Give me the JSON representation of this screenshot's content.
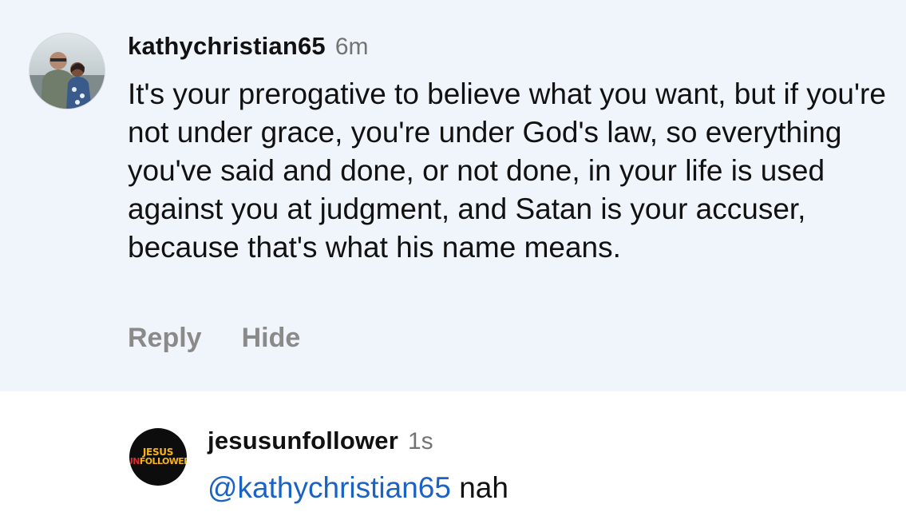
{
  "main_comment": {
    "username": "kathychristian65",
    "timestamp": "6m",
    "avatar_icon": "profile-photo-couple",
    "text": "It's your prerogative to believe what you want, but if you're not under grace, you're under God's law, so everything you've said and done, or not done, in your life is used against you at judgment, and Satan is your accuser, because that's what his name means.",
    "actions": {
      "reply_label": "Reply",
      "hide_label": "Hide"
    }
  },
  "reply_comment": {
    "username": "jesusunfollower",
    "timestamp": "1s",
    "avatar_logo": {
      "line1": "JESUS",
      "line2_prefix": "UN",
      "line2_suffix": "FOLLOWER"
    },
    "mention": "@kathychristian65",
    "text": " nah"
  },
  "colors": {
    "highlight_background": "#eff5fb",
    "mention_blue": "#1a63c4",
    "muted_gray": "#737373",
    "logo_gold": "#f6b31b",
    "logo_red": "#e4262b"
  }
}
